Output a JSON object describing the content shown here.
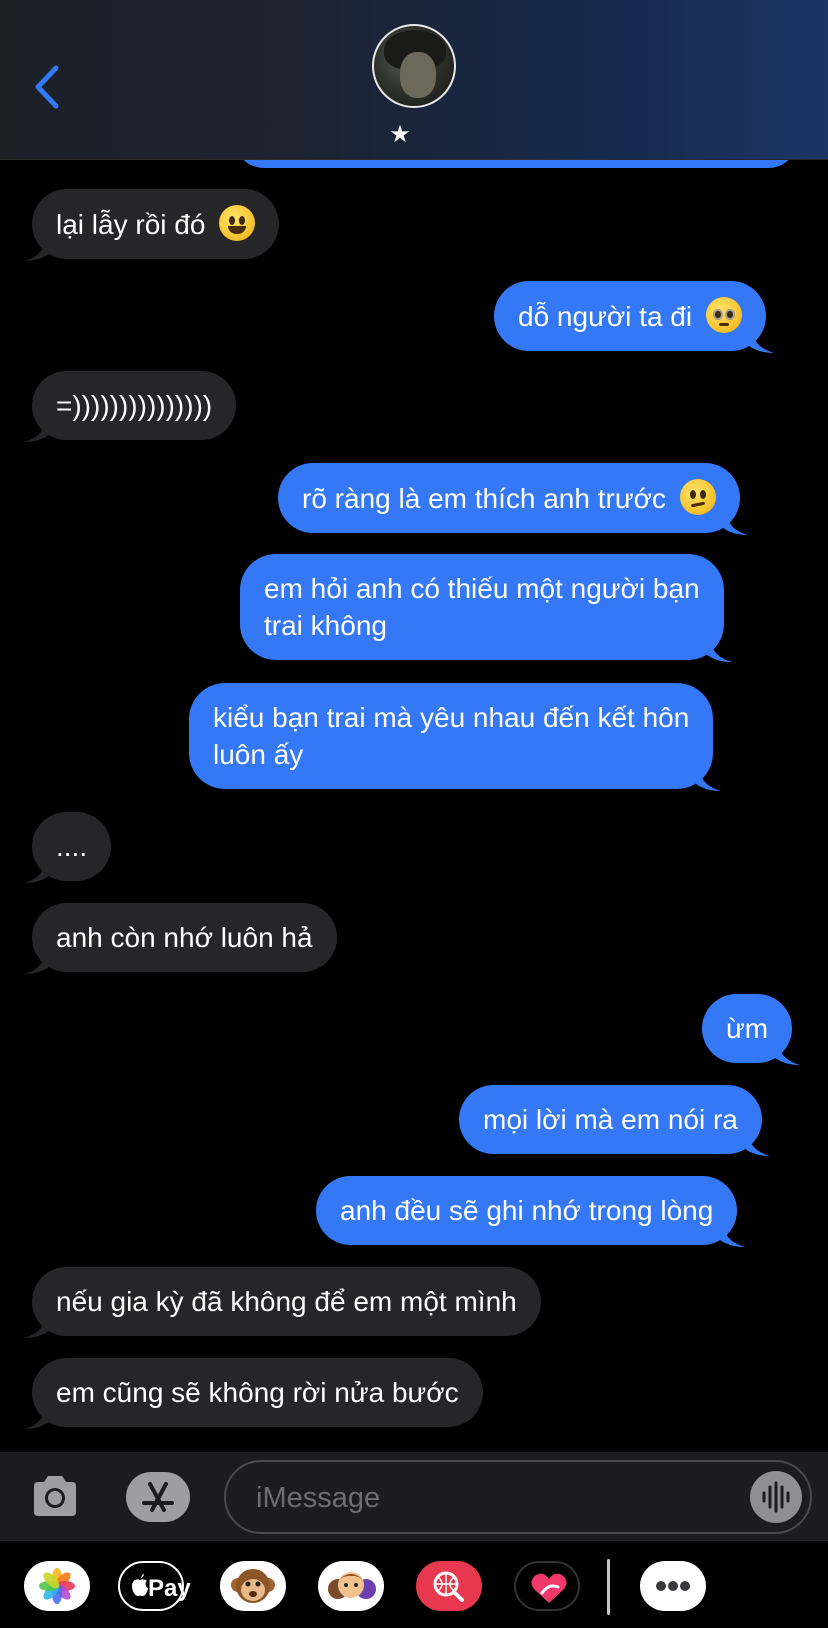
{
  "header": {
    "contact_name": "★",
    "back_icon": "chevron-left-icon",
    "accent": "#3478f6"
  },
  "messages": [
    {
      "side": "out",
      "text": ""
    },
    {
      "side": "in",
      "text": "lại lẫy rồi đó",
      "emoji": "grinning-face"
    },
    {
      "side": "out",
      "text": "dỗ người ta đi",
      "emoji": "pleading-face"
    },
    {
      "side": "in",
      "text": "=)))))))))))))))"
    },
    {
      "side": "out",
      "text": "rõ ràng là em thích anh trước",
      "emoji": "confused-face"
    },
    {
      "side": "out",
      "text": "em hỏi anh có thiếu một người bạn trai không",
      "lines": [
        "em hỏi anh có thiếu một người bạn",
        "trai không"
      ]
    },
    {
      "side": "out",
      "text": "kiểu bạn trai mà yêu nhau đến kết hôn luôn ấy",
      "lines": [
        "kiểu bạn trai mà yêu nhau đến kết hôn",
        "luôn ấy"
      ]
    },
    {
      "side": "in",
      "text": "...."
    },
    {
      "side": "in",
      "text": "anh còn nhớ luôn hả"
    },
    {
      "side": "out",
      "text": "ừm"
    },
    {
      "side": "out",
      "text": "mọi lời mà em nói ra"
    },
    {
      "side": "out",
      "text": "anh đều sẽ ghi nhớ trong lòng"
    },
    {
      "side": "in",
      "text": "nếu gia kỳ đã không để em một mình"
    },
    {
      "side": "in",
      "text": "em cũng sẽ không rời nửa bước"
    }
  ],
  "input": {
    "placeholder": "iMessage",
    "camera_icon": "camera-icon",
    "appstore_icon": "app-store-icon",
    "audio_icon": "audio-waveform-icon"
  },
  "apps": {
    "photos": "photos-icon",
    "apple_pay_label": "Pay",
    "animoji": "monkey-animoji-icon",
    "memoji": "memoji-stickers-icon",
    "images_search": "images-search-icon",
    "digital_touch": "digital-touch-heart-icon",
    "more": "more-icon"
  },
  "colors": {
    "incoming": "#262628",
    "outgoing": "#3478f6",
    "background": "#000000"
  }
}
